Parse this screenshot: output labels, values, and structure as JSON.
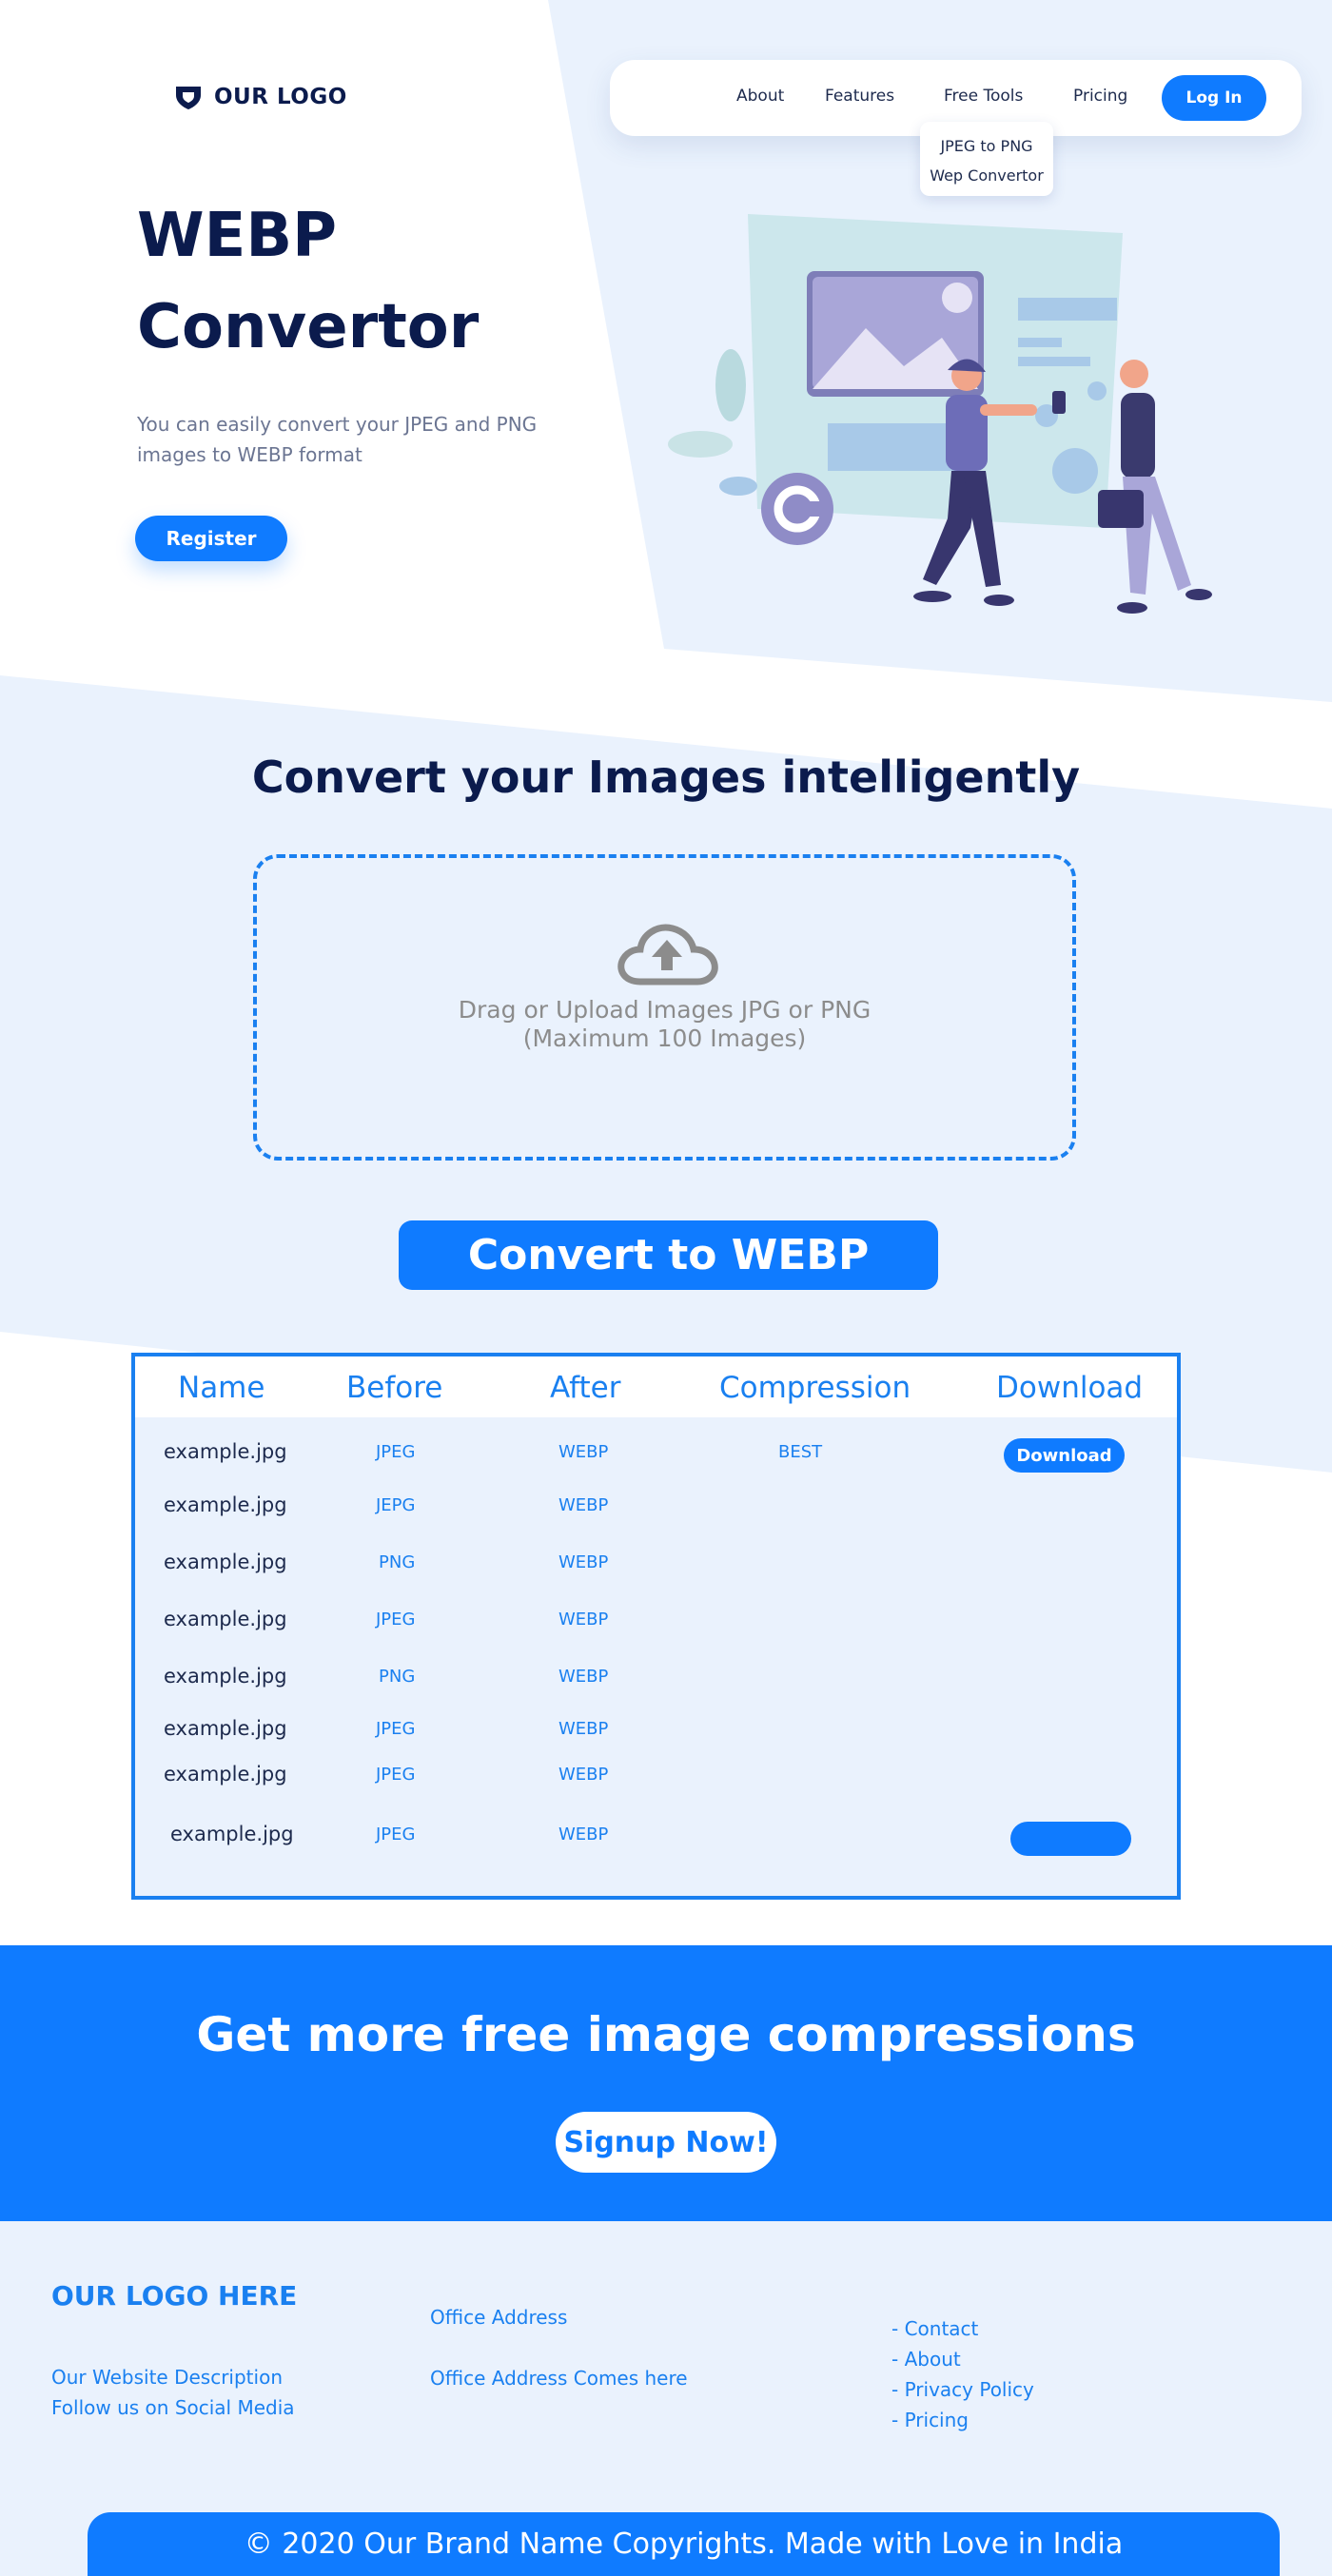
{
  "brand": {
    "logo_text": "OUR LOGO",
    "primary_color": "#0f7bff",
    "dark_color": "#0b1b4d",
    "light_bg": "#eaf2fd"
  },
  "nav": {
    "items": [
      "About",
      "Features",
      "Free Tools",
      "Pricing"
    ],
    "login_label": "Log In",
    "dropdown": [
      "JPEG to PNG",
      "Wep Convertor"
    ]
  },
  "hero": {
    "title_line1": "WEBP",
    "title_line2": "Convertor",
    "description": "You can easily convert your JPEG and PNG images to WEBP format",
    "register_label": "Register"
  },
  "converter": {
    "title": "Convert your Images intelligently",
    "upload_icon": "cloud-upload-icon",
    "upload_line1": "Drag or Upload Images JPG or PNG",
    "upload_line2": "(Maximum 100 Images)",
    "convert_label": "Convert to WEBP"
  },
  "table": {
    "headers": [
      "Name",
      "Before",
      "After",
      "Compression",
      "Download"
    ],
    "rows": [
      {
        "name": "example.jpg",
        "before": "JPEG",
        "after": "WEBP",
        "compression": "BEST",
        "download": "Download"
      },
      {
        "name": "example.jpg",
        "before": "JEPG",
        "after": "WEBP",
        "compression": "",
        "download": ""
      },
      {
        "name": "example.jpg",
        "before": "PNG",
        "after": "WEBP",
        "compression": "",
        "download": ""
      },
      {
        "name": "example.jpg",
        "before": "JPEG",
        "after": "WEBP",
        "compression": "",
        "download": ""
      },
      {
        "name": "example.jpg",
        "before": "PNG",
        "after": "WEBP",
        "compression": "",
        "download": ""
      },
      {
        "name": "example.jpg",
        "before": "JPEG",
        "after": "WEBP",
        "compression": "",
        "download": ""
      },
      {
        "name": "example.jpg",
        "before": "JPEG",
        "after": "WEBP",
        "compression": "",
        "download": ""
      },
      {
        "name": "example.jpg",
        "before": "JPEG",
        "after": "WEBP",
        "compression": "",
        "download": ""
      }
    ]
  },
  "cta": {
    "title": "Get more free image compressions",
    "signup_label": "Signup Now!"
  },
  "footer": {
    "logo": "OUR LOGO HERE",
    "description": "Our Website Description",
    "social": "Follow us on Social Media",
    "office_title": "Office Address",
    "office_text": "Office Address Comes here",
    "links": [
      "- Contact",
      "- About",
      "- Privacy Policy",
      "- Pricing"
    ],
    "copyright": "© 2020 Our Brand Name Copyrights. Made with Love in India"
  }
}
